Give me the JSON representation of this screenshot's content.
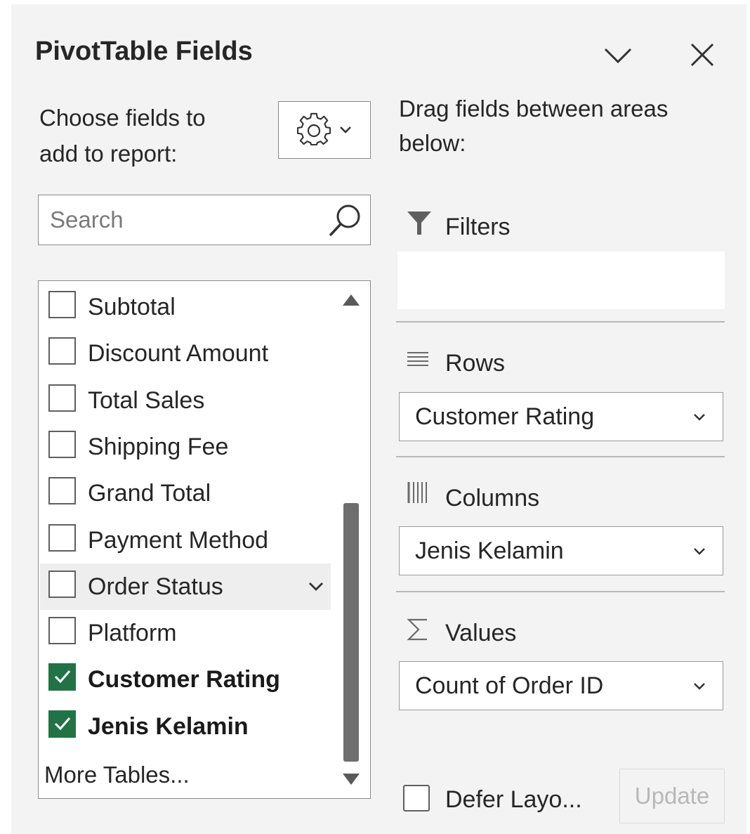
{
  "pane": {
    "title": "PivotTable Fields"
  },
  "left": {
    "choose_line1": "Choose fields to",
    "choose_line2": "add to report:",
    "search_placeholder": "Search",
    "fields": [
      {
        "label": "Subtotal",
        "checked": false
      },
      {
        "label": "Discount Amount",
        "checked": false
      },
      {
        "label": "Total Sales",
        "checked": false
      },
      {
        "label": "Shipping Fee",
        "checked": false
      },
      {
        "label": "Grand Total",
        "checked": false
      },
      {
        "label": "Payment Method",
        "checked": false
      },
      {
        "label": "Order Status",
        "checked": false,
        "hovered": true
      },
      {
        "label": "Platform",
        "checked": false
      },
      {
        "label": "Customer Rating",
        "checked": true
      },
      {
        "label": "Jenis Kelamin",
        "checked": true
      }
    ],
    "more_tables": "More Tables..."
  },
  "right": {
    "drag_line1": "Drag fields between areas",
    "drag_line2": "below:",
    "filters_label": "Filters",
    "rows_label": "Rows",
    "rows_field": "Customer Rating",
    "columns_label": "Columns",
    "columns_field": "Jenis Kelamin",
    "values_label": "Values",
    "values_field": "Count of Order ID",
    "defer_label": "Defer Layo...",
    "defer_checked": false,
    "update_label": "Update"
  },
  "colors": {
    "pane_bg": "#f3f3f3",
    "checked_green": "#217346",
    "scroll_thumb": "#6e6e6e"
  }
}
